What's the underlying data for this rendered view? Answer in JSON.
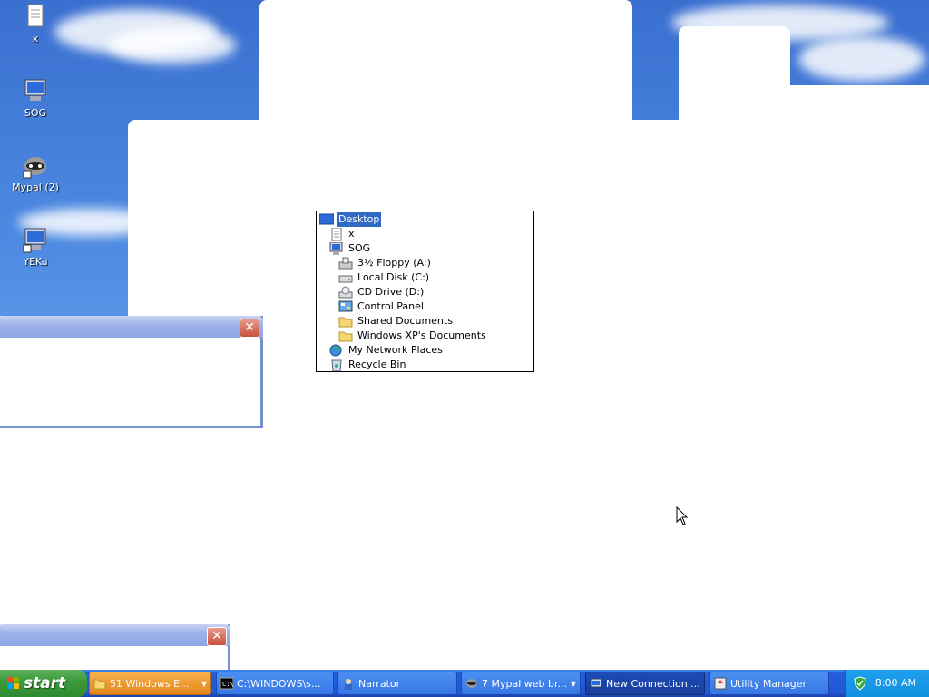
{
  "desktop_icons": [
    {
      "label": "x",
      "icon": "document-icon"
    },
    {
      "label": "SOG",
      "icon": "computer-icon"
    },
    {
      "label": "Mypal (2)",
      "icon": "raccoon-shortcut-icon"
    },
    {
      "label": "YEKu",
      "icon": "computer-shortcut-icon"
    }
  ],
  "tree": {
    "items": [
      {
        "label": "Desktop",
        "icon": "desktop-icon",
        "selected": true
      },
      {
        "label": "x",
        "icon": "document-icon"
      },
      {
        "label": "SOG",
        "icon": "computer-icon"
      },
      {
        "label": "3½ Floppy (A:)",
        "icon": "floppy-icon"
      },
      {
        "label": "Local Disk (C:)",
        "icon": "hard-disk-icon"
      },
      {
        "label": "CD Drive (D:)",
        "icon": "cd-drive-icon"
      },
      {
        "label": "Control Panel",
        "icon": "control-panel-icon"
      },
      {
        "label": "Shared Documents",
        "icon": "folder-icon"
      },
      {
        "label": "Windows XP's Documents",
        "icon": "folder-icon"
      },
      {
        "label": "My Network Places",
        "icon": "network-icon"
      },
      {
        "label": "Recycle Bin",
        "icon": "recycle-bin-icon"
      }
    ]
  },
  "dialogs": {
    "close_glyph": "✕"
  },
  "taskbar": {
    "start_label": "start",
    "tasks": [
      {
        "label": "51 Windows E...",
        "icon": "folder-icon",
        "style": "orange",
        "has_arrow": true
      },
      {
        "label": "C:\\WINDOWS\\s...",
        "icon": "console-icon",
        "style": "normal",
        "has_arrow": false
      },
      {
        "label": "Narrator",
        "icon": "narrator-icon",
        "style": "normal",
        "has_arrow": false
      },
      {
        "label": "7 Mypal web br...",
        "icon": "raccoon-icon",
        "style": "normal",
        "has_arrow": true
      },
      {
        "label": "New Connection ...",
        "icon": "connection-icon",
        "style": "active",
        "has_arrow": false
      },
      {
        "label": "Utility Manager",
        "icon": "utility-manager-icon",
        "style": "normal",
        "has_arrow": false
      }
    ],
    "clock": "8:00 AM",
    "tray_icon": "security-shield-icon"
  },
  "colors": {
    "selection": "#316ac5",
    "taskbar": "#245edb",
    "start_green": "#3c9a3c"
  }
}
